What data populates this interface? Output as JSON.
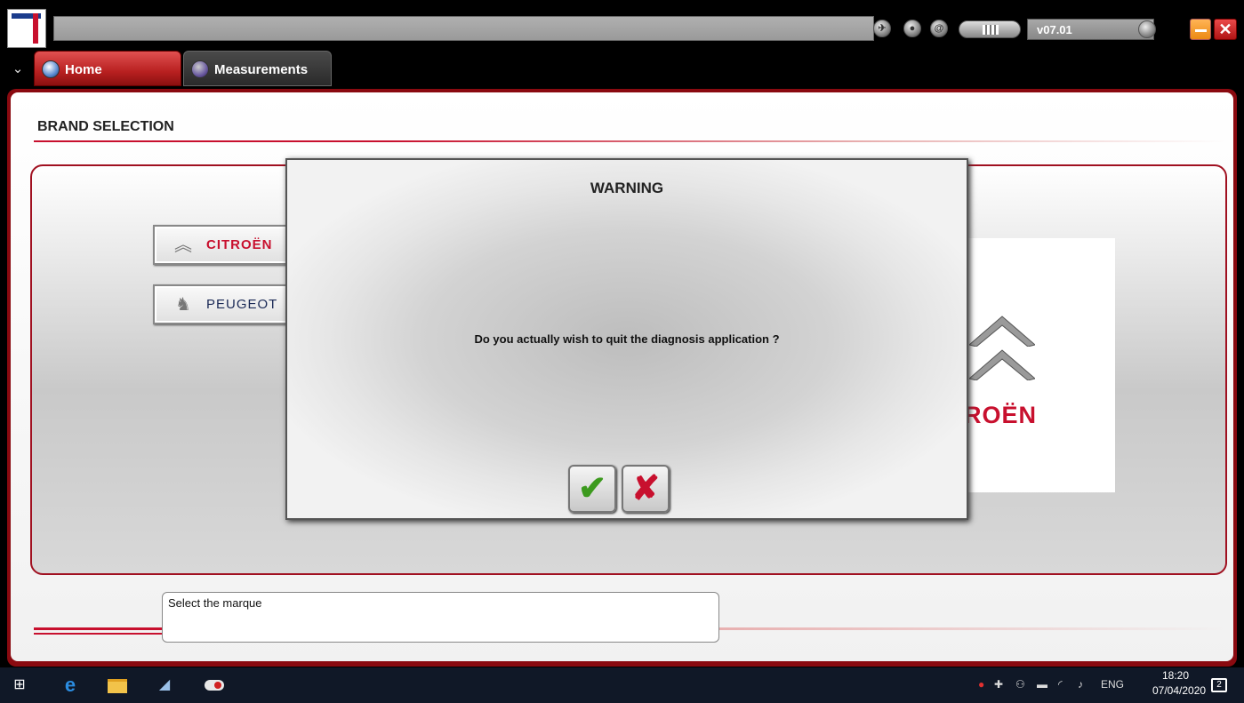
{
  "window": {
    "version": "v07.01",
    "icons": [
      "globe-icon",
      "user-icon",
      "at-icon",
      "battery-icon",
      "power-icon"
    ]
  },
  "tabs": [
    {
      "label": "Home",
      "icon": "home-globe-icon",
      "active": true
    },
    {
      "label": "Measurements",
      "icon": "waveform-icon",
      "active": false
    }
  ],
  "page": {
    "title": "BRAND SELECTION"
  },
  "brands": [
    {
      "label": "CITROËN",
      "icon": "citroen-chevrons-icon"
    },
    {
      "label": "PEUGEOT",
      "icon": "peugeot-lion-icon"
    }
  ],
  "preview": {
    "brand_text": "ROËN"
  },
  "dialog": {
    "title": "WARNING",
    "message": "Do you actually wish to quit the diagnosis application ?",
    "confirm_icon": "checkmark-icon",
    "cancel_icon": "cross-icon"
  },
  "status": {
    "text": "Select the marque"
  },
  "taskbar": {
    "language": "ENG",
    "time": "18:20",
    "date": "07/04/2020",
    "notifications": "2"
  },
  "colors": {
    "brand_red": "#c8102e",
    "frame_red": "#8a0a10",
    "taskbar": "#101827"
  }
}
